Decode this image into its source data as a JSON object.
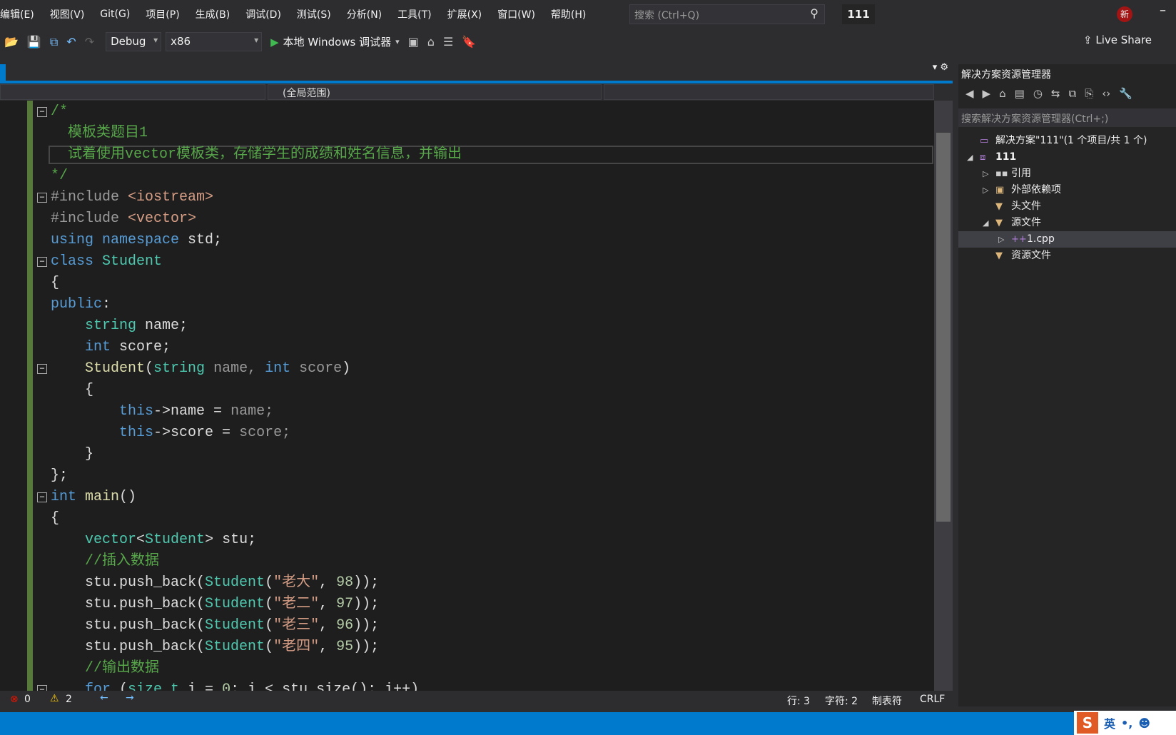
{
  "menu": [
    "编辑(E)",
    "视图(V)",
    "Git(G)",
    "项目(P)",
    "生成(B)",
    "调试(D)",
    "测试(S)",
    "分析(N)",
    "工具(T)",
    "扩展(X)",
    "窗口(W)",
    "帮助(H)"
  ],
  "search_placeholder": "搜索 (Ctrl+Q)",
  "window_title": "111",
  "avatar_text": "新",
  "toolbar": {
    "config": "Debug",
    "platform": "x86",
    "run_label": "本地 Windows 调试器",
    "live_share": "Live Share"
  },
  "nav": {
    "scope": "(全局范围)"
  },
  "code": [
    [
      [
        "/*",
        "cm"
      ]
    ],
    [
      [
        "  模板类题目1",
        "cm"
      ]
    ],
    [
      [
        "  试着使用vector模板类，存储学生的成绩和姓名信息，并输出",
        "cm"
      ]
    ],
    [
      [
        "*/",
        "cm"
      ]
    ],
    [
      [
        "#include ",
        "pp"
      ],
      [
        "<iostream>",
        "st"
      ]
    ],
    [
      [
        "#include ",
        "pp"
      ],
      [
        "<vector>",
        "st"
      ]
    ],
    [
      [
        "using ",
        "kw"
      ],
      [
        "namespace ",
        "kw"
      ],
      [
        "std;",
        "id"
      ]
    ],
    [
      [
        "class ",
        "kw"
      ],
      [
        "Student",
        "ty"
      ]
    ],
    [
      [
        "{",
        "id"
      ]
    ],
    [
      [
        "public",
        "kw"
      ],
      [
        ":",
        "id"
      ]
    ],
    [
      [
        "    string ",
        "ty"
      ],
      [
        "name;",
        "id"
      ]
    ],
    [
      [
        "    int ",
        "kw"
      ],
      [
        "score;",
        "id"
      ]
    ],
    [
      [
        "    Student",
        "fn"
      ],
      [
        "(",
        "id"
      ],
      [
        "string ",
        "ty"
      ],
      [
        "name, ",
        "pa"
      ],
      [
        "int ",
        "kw"
      ],
      [
        "score",
        "pa"
      ],
      [
        ")",
        "id"
      ]
    ],
    [
      [
        "    {",
        "id"
      ]
    ],
    [
      [
        "        this",
        "kw"
      ],
      [
        "->",
        "id"
      ],
      [
        "name = ",
        "id"
      ],
      [
        "name;",
        "pa"
      ]
    ],
    [
      [
        "        this",
        "kw"
      ],
      [
        "->",
        "id"
      ],
      [
        "score = ",
        "id"
      ],
      [
        "score;",
        "pa"
      ]
    ],
    [
      [
        "    }",
        "id"
      ]
    ],
    [
      [
        "};",
        "id"
      ]
    ],
    [
      [
        "int ",
        "kw"
      ],
      [
        "main",
        "fn"
      ],
      [
        "()",
        "id"
      ]
    ],
    [
      [
        "{",
        "id"
      ]
    ],
    [
      [
        "    vector",
        "ty"
      ],
      [
        "<",
        "id"
      ],
      [
        "Student",
        "ty"
      ],
      [
        "> ",
        "id"
      ],
      [
        "stu;",
        "id"
      ]
    ],
    [
      [
        "    //插入数据",
        "cm"
      ]
    ],
    [
      [
        "    stu.push_back(",
        "id"
      ],
      [
        "Student",
        "ty"
      ],
      [
        "(",
        "id"
      ],
      [
        "\"老大\"",
        "st"
      ],
      [
        ", ",
        "id"
      ],
      [
        "98",
        "nm"
      ],
      [
        "));",
        "id"
      ]
    ],
    [
      [
        "    stu.push_back(",
        "id"
      ],
      [
        "Student",
        "ty"
      ],
      [
        "(",
        "id"
      ],
      [
        "\"老二\"",
        "st"
      ],
      [
        ", ",
        "id"
      ],
      [
        "97",
        "nm"
      ],
      [
        "));",
        "id"
      ]
    ],
    [
      [
        "    stu.push_back(",
        "id"
      ],
      [
        "Student",
        "ty"
      ],
      [
        "(",
        "id"
      ],
      [
        "\"老三\"",
        "st"
      ],
      [
        ", ",
        "id"
      ],
      [
        "96",
        "nm"
      ],
      [
        "));",
        "id"
      ]
    ],
    [
      [
        "    stu.push_back(",
        "id"
      ],
      [
        "Student",
        "ty"
      ],
      [
        "(",
        "id"
      ],
      [
        "\"老四\"",
        "st"
      ],
      [
        ", ",
        "id"
      ],
      [
        "95",
        "nm"
      ],
      [
        "));",
        "id"
      ]
    ],
    [
      [
        "    //输出数据",
        "cm"
      ]
    ],
    [
      [
        "    for ",
        "kw"
      ],
      [
        "(",
        "id"
      ],
      [
        "size_t ",
        "ty"
      ],
      [
        "i = ",
        "id"
      ],
      [
        "0",
        "nm"
      ],
      [
        "; i < stu.size(); i++)",
        "id"
      ]
    ]
  ],
  "fold_lines": [
    0,
    4,
    7,
    12,
    18,
    27
  ],
  "current_line": 2,
  "status": {
    "errors": "0",
    "warnings": "2",
    "line": "行: 3",
    "col": "字符: 2",
    "tabs": "制表符",
    "eol": "CRLF"
  },
  "solution_explorer": {
    "title": "解决方案资源管理器",
    "search_placeholder": "搜索解决方案资源管理器(Ctrl+;)",
    "items": [
      {
        "label": "解决方案\"111\"(1 个项目/共 1 个)",
        "depth": 0,
        "twisty": "",
        "icon": "solution-icon"
      },
      {
        "label": "111",
        "depth": 0,
        "twisty": "◢",
        "icon": "project-icon"
      },
      {
        "label": "引用",
        "depth": 1,
        "twisty": "▷",
        "icon": "references-icon"
      },
      {
        "label": "外部依赖项",
        "depth": 1,
        "twisty": "▷",
        "icon": "external-deps-icon"
      },
      {
        "label": "头文件",
        "depth": 1,
        "twisty": "",
        "icon": "filter-folder-icon"
      },
      {
        "label": "源文件",
        "depth": 1,
        "twisty": "◢",
        "icon": "filter-folder-icon"
      },
      {
        "label": "1.cpp",
        "depth": 2,
        "twisty": "▷",
        "icon": "cpp-file-icon",
        "selected": true
      },
      {
        "label": "资源文件",
        "depth": 1,
        "twisty": "",
        "icon": "filter-folder-icon"
      }
    ]
  },
  "ime": {
    "lang": "英"
  }
}
